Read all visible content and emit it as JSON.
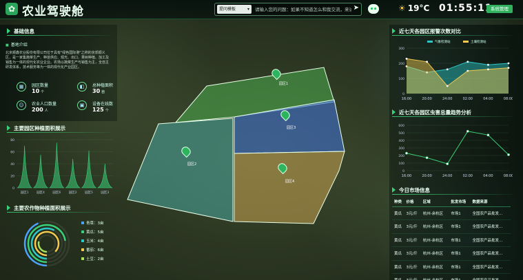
{
  "header": {
    "app_title": "农业驾驶舱",
    "logo_icon": "leaf-icon",
    "ask_mode": "提问模板",
    "ask_placeholder": "请输入您的问题：如果不知道怎么和我交流，来试...",
    "weather_temp": "19°C",
    "clock": "01:55:11",
    "system_button": "系统管理"
  },
  "basic_info": {
    "title": "基础信息",
    "subtitle": "基地介绍",
    "intro": "北京顺鑫农业股份有限公司位于具有\"绿色国际港\"之称的京郊顺义区，是一家集蔬菜生产、种苗供应、观光、出口、果树种植、加工及销售为一体的现代化农业企业。农场以蔬菜生产与销售为主，全自主研发体系，技术服务等为一体的现代化产业园区。",
    "stats": [
      {
        "icon": "building-icon",
        "label": "园区数量",
        "value": "10",
        "unit": "个"
      },
      {
        "icon": "area-icon",
        "label": "总种植面积",
        "value": "30",
        "unit": "亩"
      },
      {
        "icon": "people-icon",
        "label": "农业人口数量",
        "value": "200",
        "unit": "人"
      },
      {
        "icon": "device-icon",
        "label": "设备在线数",
        "value": "125",
        "unit": "个"
      }
    ]
  },
  "area_chart": {
    "title": "主要园区种植面积展示",
    "chart_data": {
      "type": "area",
      "categories": [
        "园区1",
        "园区4",
        "园区6",
        "园区2",
        "园区5",
        "园区3"
      ],
      "values": [
        70,
        55,
        75,
        48,
        62,
        40
      ],
      "ylim": [
        0,
        80
      ],
      "yticks": [
        "80",
        "60",
        "40",
        "20",
        "0"
      ],
      "color": "#3ad07a",
      "grid": true
    }
  },
  "crop_chart": {
    "title": "主要农作物种植面积展示",
    "chart_data": {
      "type": "pie",
      "categories": [
        "青菜",
        "黄瓜",
        "玉米",
        "番茄",
        "土豆"
      ],
      "values": [
        3,
        5,
        4,
        6,
        2
      ],
      "unit_suffix": "亩",
      "colors": [
        "#4aa3ff",
        "#3ad07a",
        "#2cc7c7",
        "#f3c94f",
        "#a7e15a"
      ]
    }
  },
  "map": {
    "zones": [
      {
        "label": "园区1",
        "color": "#4caf50"
      },
      {
        "label": "园区2",
        "color": "#4aa8a0"
      },
      {
        "label": "园区3",
        "color": "#3f6fd0"
      },
      {
        "label": "园区4",
        "color": "#c8a452"
      }
    ]
  },
  "alarm_chart": {
    "title": "近七天各园区报警次数对比",
    "chart_data": {
      "type": "area",
      "x": [
        "16:00",
        "20:00",
        "24:00",
        "02:00",
        "04:00",
        "08:00"
      ],
      "series": [
        {
          "name": "气象检测站",
          "values": [
            180,
            140,
            160,
            210,
            190,
            200
          ],
          "color": "#2cc7c7"
        },
        {
          "name": "土壤检测站",
          "values": [
            230,
            210,
            50,
            150,
            160,
            170
          ],
          "color": "#f3c94f"
        }
      ],
      "ylim": [
        0,
        300
      ],
      "yticks": [
        "300",
        "200",
        "100",
        "0"
      ]
    }
  },
  "pest_chart": {
    "title": "近七天各园区虫害总量趋势分析",
    "chart_data": {
      "type": "line",
      "x": [
        "16:00",
        "20:00",
        "24:00",
        "02:00",
        "04:00",
        "08:00"
      ],
      "values": [
        230,
        170,
        90,
        520,
        470,
        210
      ],
      "ylim": [
        0,
        600
      ],
      "yticks": [
        "600",
        "500",
        "400",
        "300",
        "200",
        "100",
        "0"
      ],
      "color": "#3ad07a"
    }
  },
  "market": {
    "title": "今日市场信息",
    "headers": [
      "种类",
      "价格",
      "区域",
      "批发市场",
      "数据来源"
    ],
    "rows": [
      [
        "黄瓜",
        "3元/斤",
        "杭州-余杭区",
        "市场1",
        "全国农产品批发..."
      ],
      [
        "黄瓜",
        "3元/斤",
        "杭州-余杭区",
        "市场1",
        "全国农产品批发..."
      ],
      [
        "黄瓜",
        "3元/斤",
        "杭州-余杭区",
        "市场1",
        "全国农产品批发..."
      ],
      [
        "黄瓜",
        "3元/斤",
        "杭州-余杭区",
        "市场1",
        "全国农产品批发..."
      ],
      [
        "黄瓜",
        "3元/斤",
        "杭州-余杭区",
        "市场1",
        "全国农产品批发..."
      ],
      [
        "黄瓜",
        "3元/斤",
        "杭州-余杭区",
        "市场1",
        "全国农产品批发..."
      ]
    ]
  }
}
